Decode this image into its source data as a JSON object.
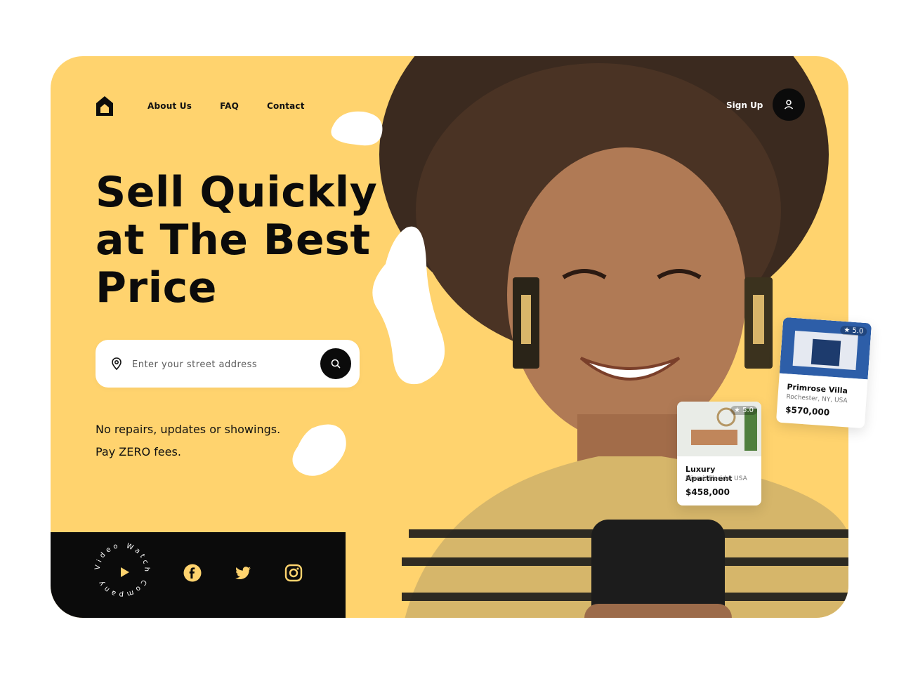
{
  "nav": {
    "links": [
      "About Us",
      "FAQ",
      "Contact"
    ],
    "signup_label": "Sign Up"
  },
  "hero": {
    "headline": "Sell Quickly\nat The Best\nPrice",
    "search_placeholder": "Enter your street address",
    "sub_line_1": "No repairs, updates or showings.",
    "sub_line_2": "Pay ZERO fees."
  },
  "footer": {
    "video_ring_text": "Video Watch Company",
    "social": [
      "facebook-icon",
      "twitter-icon",
      "instagram-icon"
    ]
  },
  "listings": [
    {
      "title": "Primrose Villa",
      "location": "Rochester, NY, USA",
      "price": "$570,000",
      "rating": "5.0"
    },
    {
      "title": "Luxury Apartment",
      "location": "Miami, Florida, USA",
      "price": "$458,000",
      "rating": "5.0"
    }
  ],
  "colors": {
    "accent": "#FFD36E",
    "dark": "#0b0b0b"
  }
}
